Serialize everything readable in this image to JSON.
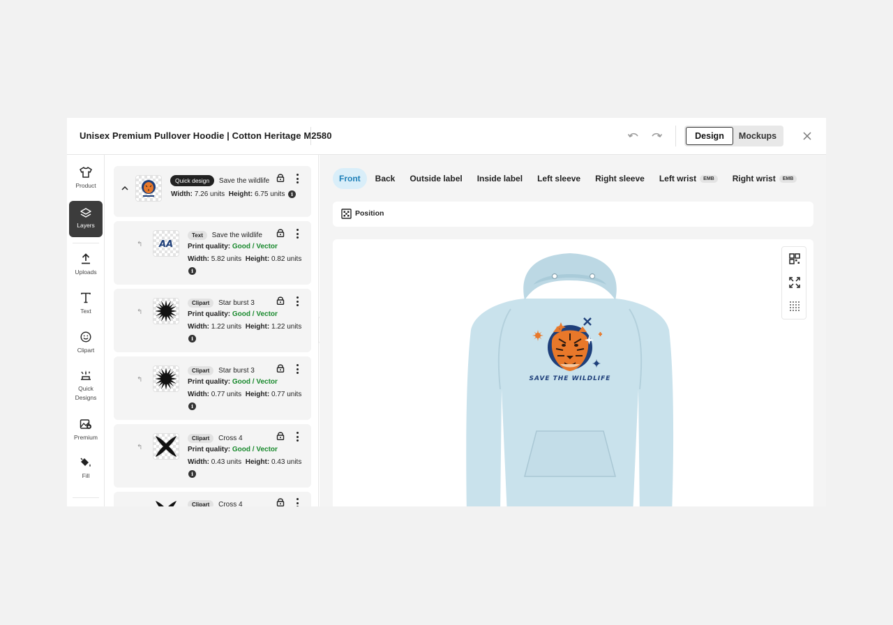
{
  "header": {
    "title": "Unisex Premium Pullover Hoodie | Cotton Heritage M2580",
    "design_label": "Design",
    "mockups_label": "Mockups"
  },
  "nav": {
    "items": [
      {
        "label": "Product",
        "icon": "shirt-icon"
      },
      {
        "label": "Layers",
        "icon": "layers-icon"
      },
      {
        "label": "Uploads",
        "icon": "upload-icon"
      },
      {
        "label": "Text",
        "icon": "text-icon"
      },
      {
        "label": "Clipart",
        "icon": "smiley-icon"
      },
      {
        "label": "Quick Designs",
        "icon": "sparkle-icon"
      },
      {
        "label": "Premium",
        "icon": "premium-icon"
      },
      {
        "label": "Fill",
        "icon": "paint-bucket-icon"
      }
    ]
  },
  "layers": {
    "group": {
      "tag": "Quick design",
      "name": "Save the wildlife",
      "width_label": "Width:",
      "width": "7.26 units",
      "height_label": "Height:",
      "height": "6.75 units"
    },
    "items": [
      {
        "tag": "Text",
        "name": "Save the wildlife",
        "quality_label": "Print quality:",
        "quality": "Good / Vector",
        "width_label": "Width:",
        "width": "5.82 units",
        "height_label": "Height:",
        "height": "0.82 units",
        "thumb": "text-thumb"
      },
      {
        "tag": "Clipart",
        "name": "Star burst 3",
        "quality_label": "Print quality:",
        "quality": "Good / Vector",
        "width_label": "Width:",
        "width": "1.22 units",
        "height_label": "Height:",
        "height": "1.22 units",
        "thumb": "starburst"
      },
      {
        "tag": "Clipart",
        "name": "Star burst 3",
        "quality_label": "Print quality:",
        "quality": "Good / Vector",
        "width_label": "Width:",
        "width": "0.77 units",
        "height_label": "Height:",
        "height": "0.77 units",
        "thumb": "starburst"
      },
      {
        "tag": "Clipart",
        "name": "Cross 4",
        "quality_label": "Print quality:",
        "quality": "Good / Vector",
        "width_label": "Width:",
        "width": "0.43 units",
        "height_label": "Height:",
        "height": "0.43 units",
        "thumb": "cross"
      },
      {
        "tag": "Clipart",
        "name": "Cross 4"
      }
    ]
  },
  "placement_tabs": [
    {
      "label": "Front",
      "active": true
    },
    {
      "label": "Back"
    },
    {
      "label": "Outside label"
    },
    {
      "label": "Inside label"
    },
    {
      "label": "Left sleeve"
    },
    {
      "label": "Right sleeve"
    },
    {
      "label": "Left wrist",
      "badge": "EMB"
    },
    {
      "label": "Right wrist",
      "badge": "EMB"
    }
  ],
  "position_label": "Position",
  "design_text": "SAVE THE WILDLIFE",
  "colors": {
    "hoodie": "#c9e2ec",
    "accent_blue": "#1d7fb8",
    "good_green": "#1a8a2e",
    "tiger_orange": "#e8782a",
    "navy": "#1e3f7a"
  }
}
